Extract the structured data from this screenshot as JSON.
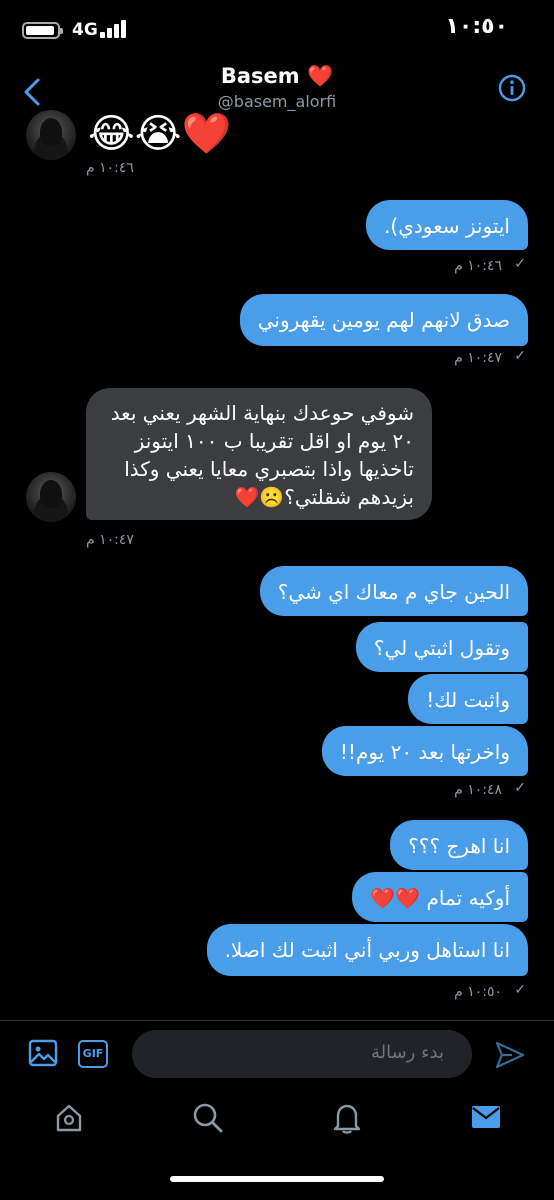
{
  "status_bar": {
    "time": "١٠:٥٠",
    "network": "4G",
    "battery_level": 0.85
  },
  "header": {
    "name": "Basem ❤️",
    "handle": "@basem_alorfi",
    "back_icon": "chevron-left-icon",
    "info_icon": "info-icon",
    "accent_color": "#4a9de8"
  },
  "messages": {
    "m0_emoji": "😂😭❤️",
    "m0_time": "١٠:٤٦ م",
    "m1_text": "ايتونز سعودي).",
    "m1_time": "١٠:٤٦ م",
    "m2_text": "صدق لانهم لهم يومين يقهروني",
    "m2_time": "١٠:٤٧ م",
    "m3_line1": "شوفي حوعدك بنهاية الشهر يعني بعد",
    "m3_line2": "٢٠ يوم او اقل تقريبا ب ١٠٠ ايتونز",
    "m3_line3": "تاخذيها واذا بتصبري معايا يعني وكذا",
    "m3_line4": "بزيدهم شقلتي؟☹️❤️",
    "m3_time": "١٠:٤٧ م",
    "m4_text": "الحين جاي م معاك اي شي؟",
    "m5_text": "وتقول اثبتي لي؟",
    "m6_text": "واثبت لك!",
    "m7_text": "واخرتها بعد ٢٠ يوم!!",
    "m7_time": "١٠:٤٨ م",
    "m8_text": "انا اهرج ؟؟؟",
    "m9_text": "أوكيه تمام ❤️❤️",
    "m10_text": "انا استاهل وربي أني اثبت لك اصلا.",
    "m10_time": "١٠:٥٠ م"
  },
  "composer": {
    "placeholder": "بدء رسالة",
    "image_icon": "image-icon",
    "gif_label": "GIF",
    "send_icon": "send-icon"
  },
  "tabbar": {
    "items": [
      "home-icon",
      "search-icon",
      "bell-icon",
      "mail-icon"
    ],
    "active": "mail-icon"
  }
}
